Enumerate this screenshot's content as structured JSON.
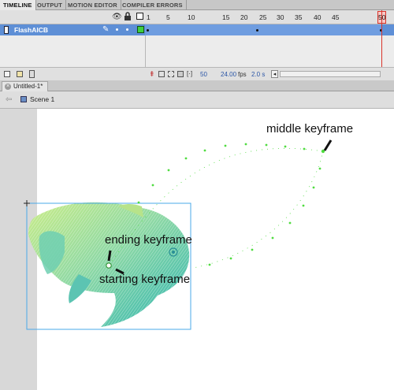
{
  "panel_tabs": [
    "TIMELINE",
    "OUTPUT",
    "MOTION EDITOR",
    "COMPILER ERRORS"
  ],
  "timeline": {
    "layer_name": "FlashAICB",
    "frame_numbers": [
      "1",
      "5",
      "10",
      "15",
      "20",
      "25",
      "30",
      "35",
      "40",
      "45",
      "50"
    ],
    "current_frame": "50",
    "frame_rate": "24.00",
    "fps_unit": "fps",
    "elapsed_time": "2.0 s"
  },
  "document": {
    "tab_title": "Untitled-1*",
    "scene": "Scene 1"
  },
  "annotations": {
    "middle": "middle keyframe",
    "ending": "ending keyframe",
    "starting": "starting keyframe"
  },
  "colors": {
    "layer_highlight": "#5e8fd6",
    "playhead": "#d9342b",
    "motion_path": "#4fdc3f",
    "selection_box": "#4aa8e8"
  }
}
